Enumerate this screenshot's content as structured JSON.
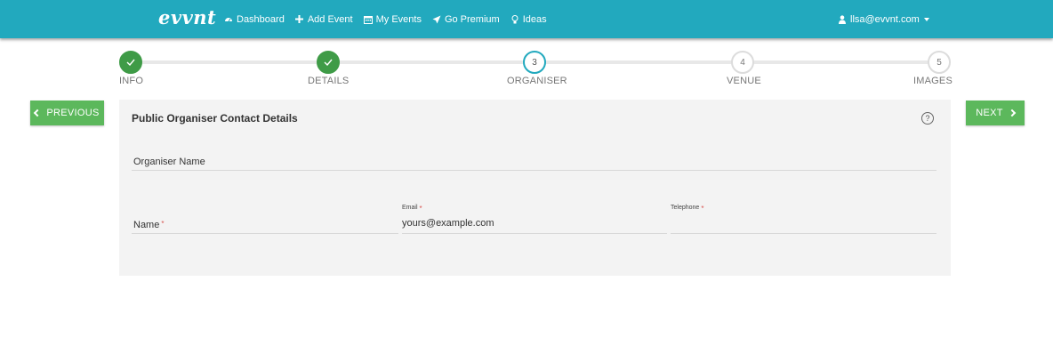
{
  "header": {
    "logo": "evvnt",
    "nav": [
      {
        "label": "Dashboard",
        "icon": "dashboard-icon"
      },
      {
        "label": "Add Event",
        "icon": "plus-icon"
      },
      {
        "label": "My Events",
        "icon": "calendar-icon"
      },
      {
        "label": "Go Premium",
        "icon": "rocket-icon"
      },
      {
        "label": "Ideas",
        "icon": "lightbulb-icon"
      }
    ],
    "user": {
      "label": "llsa@evvnt.com",
      "icon": "user-icon"
    }
  },
  "stepper": {
    "steps": [
      {
        "number": "1",
        "label": "INFO",
        "state": "done"
      },
      {
        "number": "2",
        "label": "DETAILS",
        "state": "done"
      },
      {
        "number": "3",
        "label": "ORGANISER",
        "state": "current"
      },
      {
        "number": "4",
        "label": "VENUE",
        "state": "todo"
      },
      {
        "number": "5",
        "label": "IMAGES",
        "state": "todo"
      }
    ]
  },
  "buttons": {
    "previous": "PREVIOUS",
    "next": "NEXT"
  },
  "form": {
    "title": "Public Organiser Contact Details",
    "help": "?",
    "organiser_name_label": "Organiser Name",
    "name_label": "Name",
    "email_label": "Email",
    "email_value": "yours@example.com",
    "telephone_label": "Telephone",
    "required_mark": "*"
  },
  "colors": {
    "brand": "#22a9be",
    "done": "#3f9b47",
    "button": "#5cb85c"
  }
}
